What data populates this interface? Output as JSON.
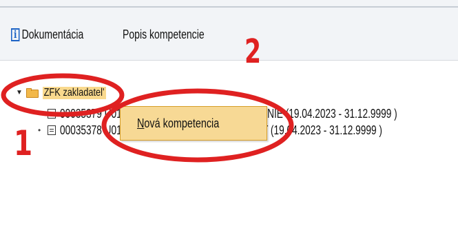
{
  "toolbar": {
    "documentation_label": "Dokumentácia",
    "popis_label": "Popis kompetencie",
    "info_icon": "info-icon"
  },
  "tree": {
    "root_label": "ZFK zakladatel'",
    "items": [
      {
        "label": "00035379 U01310 ZFKZK P.ÚČT_2 OP:ÚČTOVANIE (19.04.2023 - 31.12.9999 )"
      },
      {
        "label": "00035378 U01310 ZFKZK P.TTV_2 OP:ŽIADOST (19.04.2023 - 31.12.9999 )"
      }
    ],
    "icons": {
      "expander": "triangle-down-icon",
      "folder": "folder-open-icon",
      "document": "document-icon"
    }
  },
  "context_menu": {
    "item_label": "Nová kompetencia",
    "underline_letter": "N"
  },
  "annotations": {
    "label_1": "1",
    "label_2": "2",
    "color": "#df2121"
  },
  "colors": {
    "toolbar_bg": "#f2f4f7",
    "selected_node": "#f9d98d",
    "menu_bg": "#f7d995",
    "menu_border": "#d59d28",
    "annotation": "#df2121",
    "info_icon": "#1d63c5"
  }
}
